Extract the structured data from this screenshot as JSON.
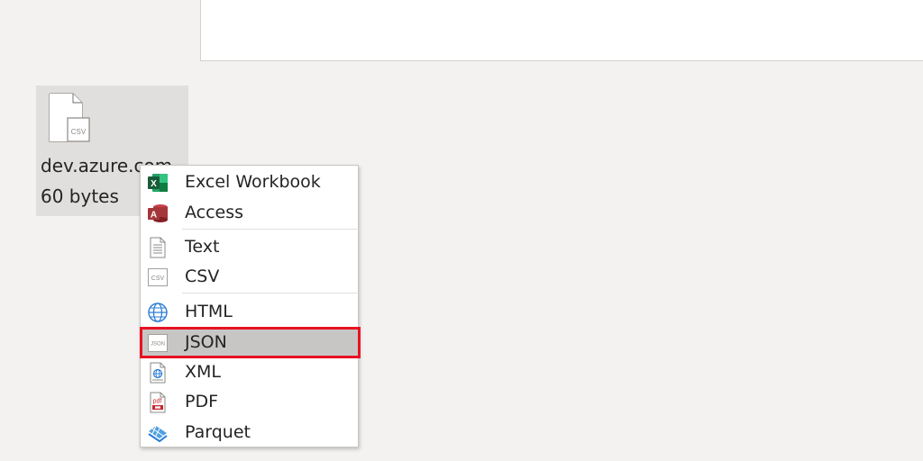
{
  "file": {
    "name": "dev.azure.com",
    "size": "60 bytes",
    "icon": "csv-file-icon",
    "icon_text": "CSV"
  },
  "menu": {
    "items": [
      {
        "label": "Excel Workbook",
        "icon": "excel-icon"
      },
      {
        "label": "Access",
        "icon": "access-icon"
      },
      {
        "label": "Text",
        "icon": "text-file-icon"
      },
      {
        "label": "CSV",
        "icon": "csv-icon",
        "icon_text": "CSV"
      },
      {
        "label": "HTML",
        "icon": "globe-icon"
      },
      {
        "label": "JSON",
        "icon": "json-icon",
        "icon_text": "JSON",
        "selected": true
      },
      {
        "label": "XML",
        "icon": "xml-icon"
      },
      {
        "label": "PDF",
        "icon": "pdf-icon",
        "icon_text": "pdf"
      },
      {
        "label": "Parquet",
        "icon": "parquet-icon"
      }
    ]
  },
  "colors": {
    "highlight_border": "#e81123",
    "selected_bg": "#c8c6c4",
    "excel_green": "#1d6f42",
    "access_red": "#a4373a",
    "html_blue": "#2b7cd3"
  }
}
